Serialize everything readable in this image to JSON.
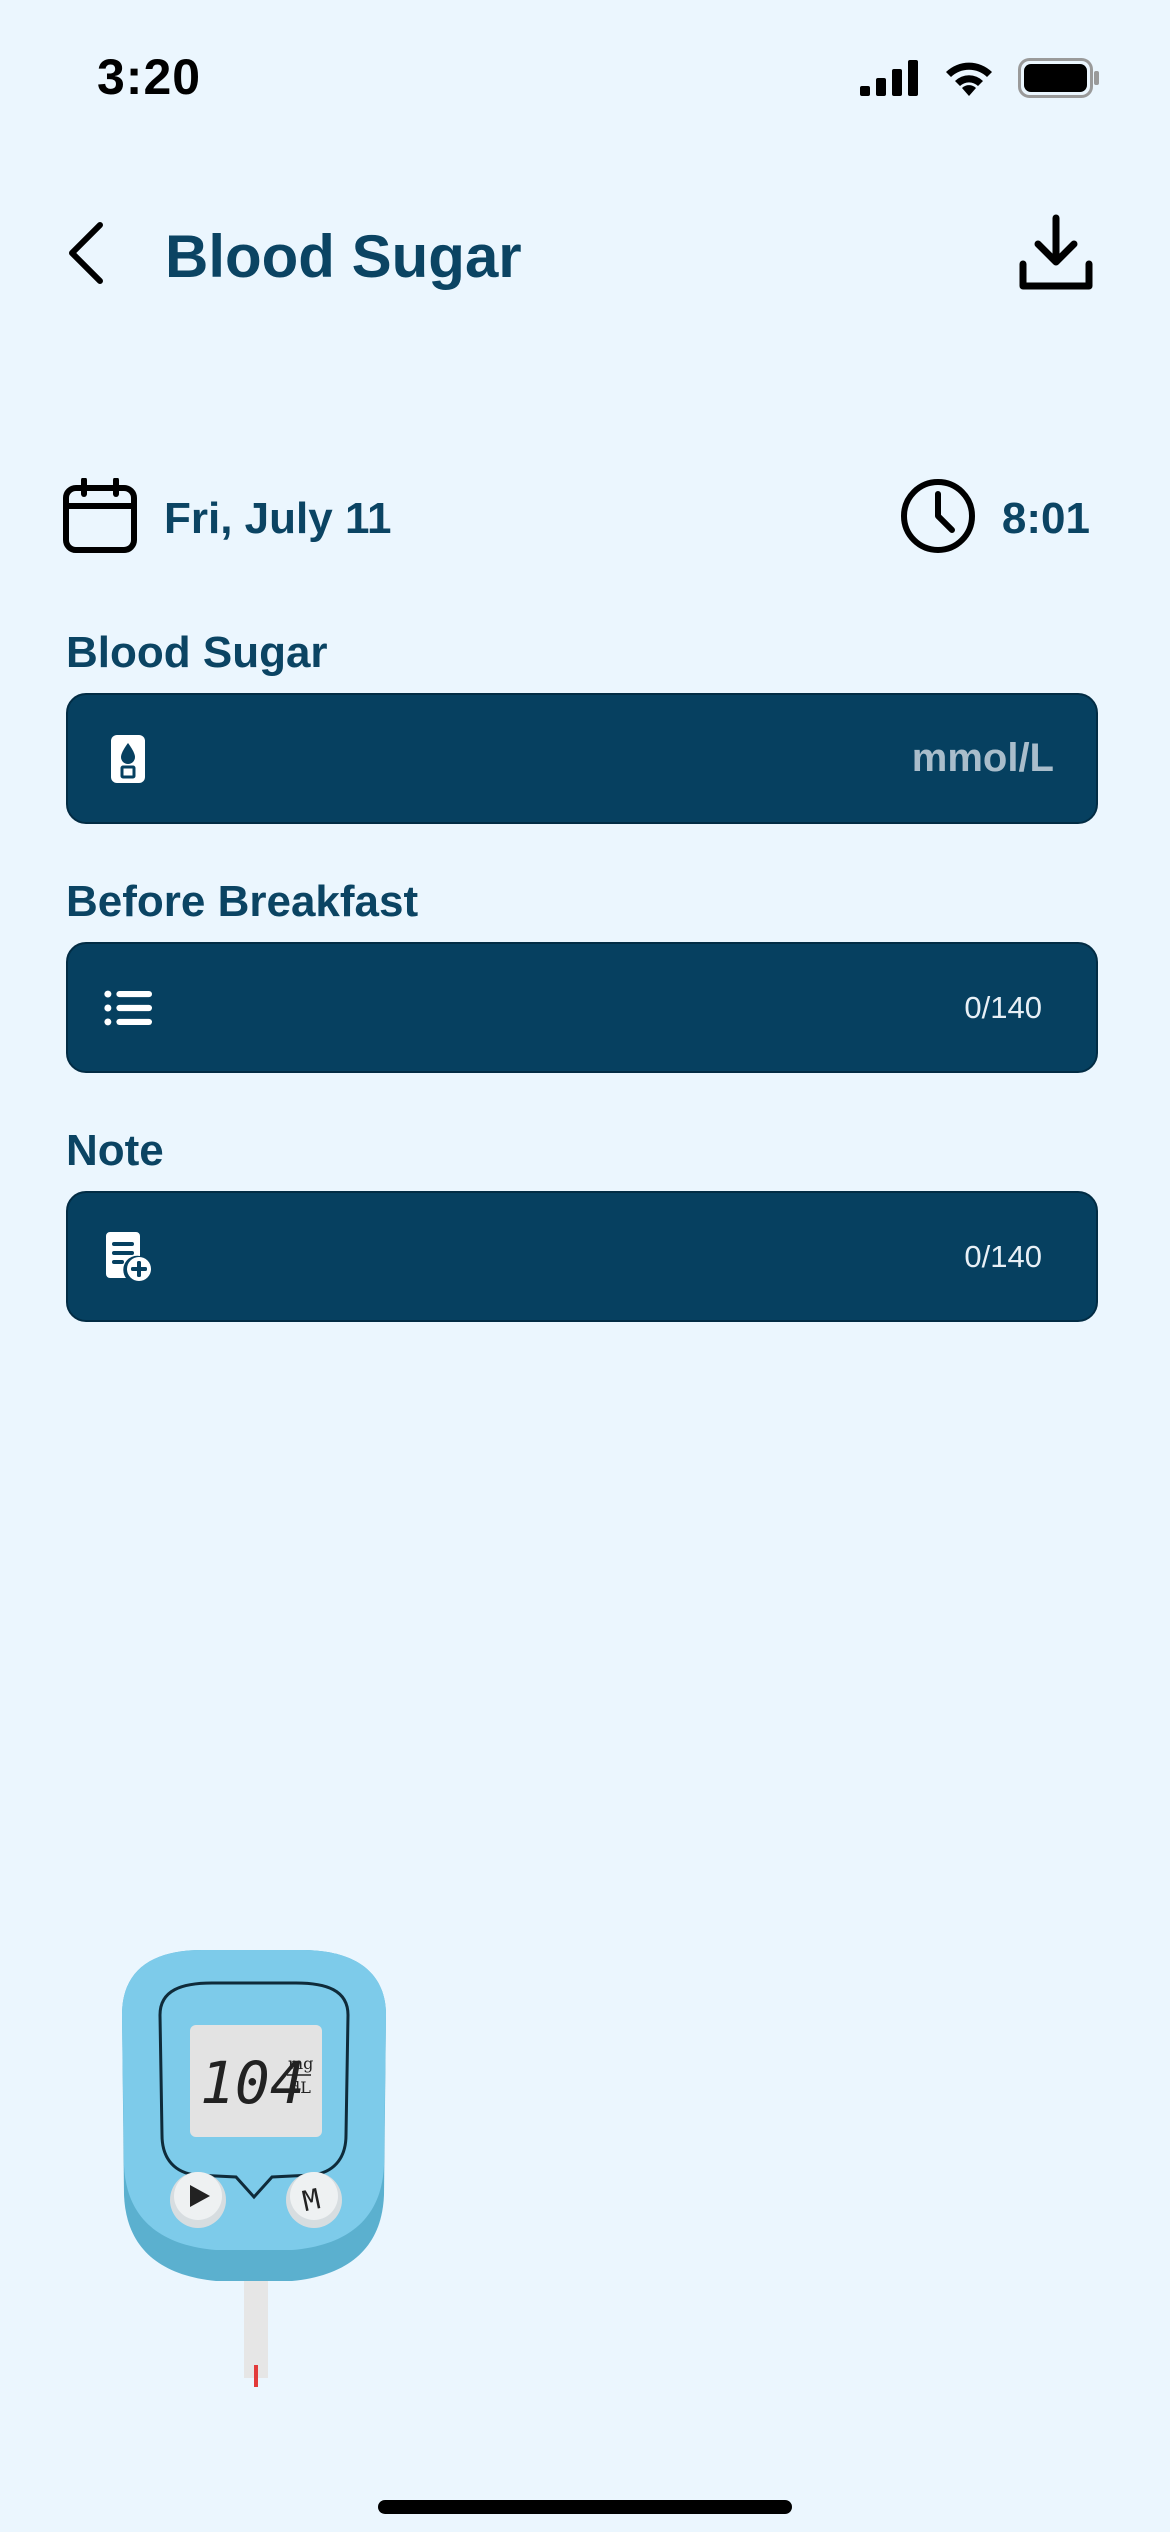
{
  "status_bar": {
    "time": "3:20",
    "icons": [
      "cellular-signal-icon",
      "wifi-icon",
      "battery-icon"
    ]
  },
  "header": {
    "title": "Blood Sugar",
    "back_icon": "chevron-left-icon",
    "action_icon": "download-icon"
  },
  "entry": {
    "date": "Fri, July 11",
    "time": "8:01"
  },
  "fields": {
    "blood_sugar": {
      "label": "Blood Sugar",
      "unit": "mmol/L",
      "icon": "glucose-meter-icon"
    },
    "meal": {
      "label": "Before Breakfast",
      "counter": "0/140",
      "icon": "list-icon"
    },
    "note": {
      "label": "Note",
      "counter": "0/140",
      "icon": "note-add-icon"
    }
  },
  "illustration": {
    "reading": "104",
    "unit_top": "mg",
    "unit_bottom": "dL",
    "button_right": "M"
  },
  "colors": {
    "background": "#EBF6FE",
    "primary": "#0B4463",
    "field_bg": "#064060",
    "meter_blue": "#7DCBEA"
  }
}
